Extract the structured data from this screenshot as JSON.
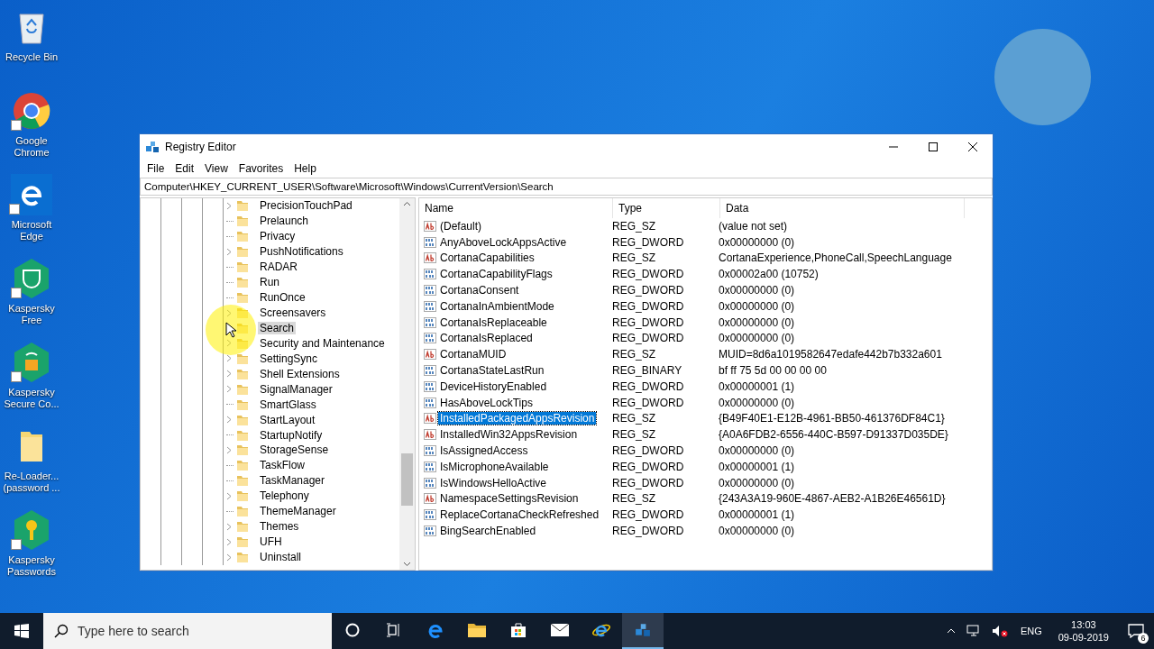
{
  "desktop_icons": [
    {
      "kind": "recycle",
      "label": "Recycle Bin",
      "shortcut": false
    },
    {
      "kind": "chrome",
      "label": "Google Chrome",
      "shortcut": true
    },
    {
      "kind": "edge",
      "label": "Microsoft Edge",
      "shortcut": true
    },
    {
      "kind": "kfree",
      "label": "Kaspersky Free",
      "shortcut": true
    },
    {
      "kind": "ksecure",
      "label": "Kaspersky Secure Co...",
      "shortcut": true
    },
    {
      "kind": "folder",
      "label": "Re-Loader... (password ...",
      "shortcut": false
    },
    {
      "kind": "kpass",
      "label": "Kaspersky Passwords",
      "shortcut": true
    }
  ],
  "window": {
    "title": "Registry Editor",
    "menu": [
      "File",
      "Edit",
      "View",
      "Favorites",
      "Help"
    ],
    "address": "Computer\\HKEY_CURRENT_USER\\Software\\Microsoft\\Windows\\CurrentVersion\\Search",
    "tree": [
      {
        "label": "PrecisionTouchPad",
        "expandable": true,
        "selected": false
      },
      {
        "label": "Prelaunch",
        "expandable": false,
        "selected": false
      },
      {
        "label": "Privacy",
        "expandable": false,
        "selected": false
      },
      {
        "label": "PushNotifications",
        "expandable": true,
        "selected": false
      },
      {
        "label": "RADAR",
        "expandable": false,
        "selected": false
      },
      {
        "label": "Run",
        "expandable": false,
        "selected": false
      },
      {
        "label": "RunOnce",
        "expandable": false,
        "selected": false
      },
      {
        "label": "Screensavers",
        "expandable": true,
        "selected": false
      },
      {
        "label": "Search",
        "expandable": true,
        "selected": true
      },
      {
        "label": "Security and Maintenance",
        "expandable": true,
        "selected": false
      },
      {
        "label": "SettingSync",
        "expandable": true,
        "selected": false
      },
      {
        "label": "Shell Extensions",
        "expandable": true,
        "selected": false
      },
      {
        "label": "SignalManager",
        "expandable": true,
        "selected": false
      },
      {
        "label": "SmartGlass",
        "expandable": false,
        "selected": false
      },
      {
        "label": "StartLayout",
        "expandable": true,
        "selected": false
      },
      {
        "label": "StartupNotify",
        "expandable": false,
        "selected": false
      },
      {
        "label": "StorageSense",
        "expandable": true,
        "selected": false
      },
      {
        "label": "TaskFlow",
        "expandable": false,
        "selected": false
      },
      {
        "label": "TaskManager",
        "expandable": false,
        "selected": false
      },
      {
        "label": "Telephony",
        "expandable": true,
        "selected": false
      },
      {
        "label": "ThemeManager",
        "expandable": false,
        "selected": false
      },
      {
        "label": "Themes",
        "expandable": true,
        "selected": false
      },
      {
        "label": "UFH",
        "expandable": true,
        "selected": false
      },
      {
        "label": "Uninstall",
        "expandable": true,
        "selected": false
      }
    ],
    "columns": [
      "Name",
      "Type",
      "Data"
    ],
    "values": [
      {
        "kind": "string",
        "name": "(Default)",
        "type": "REG_SZ",
        "data": "(value not set)",
        "selected": false
      },
      {
        "kind": "binary",
        "name": "AnyAboveLockAppsActive",
        "type": "REG_DWORD",
        "data": "0x00000000 (0)",
        "selected": false
      },
      {
        "kind": "string",
        "name": "CortanaCapabilities",
        "type": "REG_SZ",
        "data": "CortanaExperience,PhoneCall,SpeechLanguage",
        "selected": false
      },
      {
        "kind": "binary",
        "name": "CortanaCapabilityFlags",
        "type": "REG_DWORD",
        "data": "0x00002a00 (10752)",
        "selected": false
      },
      {
        "kind": "binary",
        "name": "CortanaConsent",
        "type": "REG_DWORD",
        "data": "0x00000000 (0)",
        "selected": false
      },
      {
        "kind": "binary",
        "name": "CortanaInAmbientMode",
        "type": "REG_DWORD",
        "data": "0x00000000 (0)",
        "selected": false
      },
      {
        "kind": "binary",
        "name": "CortanaIsReplaceable",
        "type": "REG_DWORD",
        "data": "0x00000000 (0)",
        "selected": false
      },
      {
        "kind": "binary",
        "name": "CortanaIsReplaced",
        "type": "REG_DWORD",
        "data": "0x00000000 (0)",
        "selected": false
      },
      {
        "kind": "string",
        "name": "CortanaMUID",
        "type": "REG_SZ",
        "data": "MUID=8d6a1019582647edafe442b7b332a601",
        "selected": false
      },
      {
        "kind": "binary",
        "name": "CortanaStateLastRun",
        "type": "REG_BINARY",
        "data": "bf ff 75 5d 00 00 00 00",
        "selected": false
      },
      {
        "kind": "binary",
        "name": "DeviceHistoryEnabled",
        "type": "REG_DWORD",
        "data": "0x00000001 (1)",
        "selected": false
      },
      {
        "kind": "binary",
        "name": "HasAboveLockTips",
        "type": "REG_DWORD",
        "data": "0x00000000 (0)",
        "selected": false
      },
      {
        "kind": "string",
        "name": "InstalledPackagedAppsRevision",
        "type": "REG_SZ",
        "data": "{B49F40E1-E12B-4961-BB50-461376DF84C1}",
        "selected": true
      },
      {
        "kind": "string",
        "name": "InstalledWin32AppsRevision",
        "type": "REG_SZ",
        "data": "{A0A6FDB2-6556-440C-B597-D91337D035DE}",
        "selected": false
      },
      {
        "kind": "binary",
        "name": "IsAssignedAccess",
        "type": "REG_DWORD",
        "data": "0x00000000 (0)",
        "selected": false
      },
      {
        "kind": "binary",
        "name": "IsMicrophoneAvailable",
        "type": "REG_DWORD",
        "data": "0x00000001 (1)",
        "selected": false
      },
      {
        "kind": "binary",
        "name": "IsWindowsHelloActive",
        "type": "REG_DWORD",
        "data": "0x00000000 (0)",
        "selected": false
      },
      {
        "kind": "string",
        "name": "NamespaceSettingsRevision",
        "type": "REG_SZ",
        "data": "{243A3A19-960E-4867-AEB2-A1B26E46561D}",
        "selected": false
      },
      {
        "kind": "binary",
        "name": "ReplaceCortanaCheckRefreshed",
        "type": "REG_DWORD",
        "data": "0x00000001 (1)",
        "selected": false
      },
      {
        "kind": "binary",
        "name": "BingSearchEnabled",
        "type": "REG_DWORD",
        "data": "0x00000000 (0)",
        "selected": false
      }
    ]
  },
  "taskbar": {
    "search_placeholder": "Type here to search",
    "apps": [
      {
        "kind": "cortana",
        "selected": false
      },
      {
        "kind": "taskview",
        "selected": false
      },
      {
        "kind": "edge",
        "selected": false
      },
      {
        "kind": "explorer",
        "selected": false
      },
      {
        "kind": "store",
        "selected": false
      },
      {
        "kind": "mail",
        "selected": false
      },
      {
        "kind": "ie",
        "selected": false
      },
      {
        "kind": "regedit",
        "selected": true
      }
    ],
    "language": "ENG",
    "time": "13:03",
    "date": "09-09-2019",
    "notifications": "6"
  }
}
